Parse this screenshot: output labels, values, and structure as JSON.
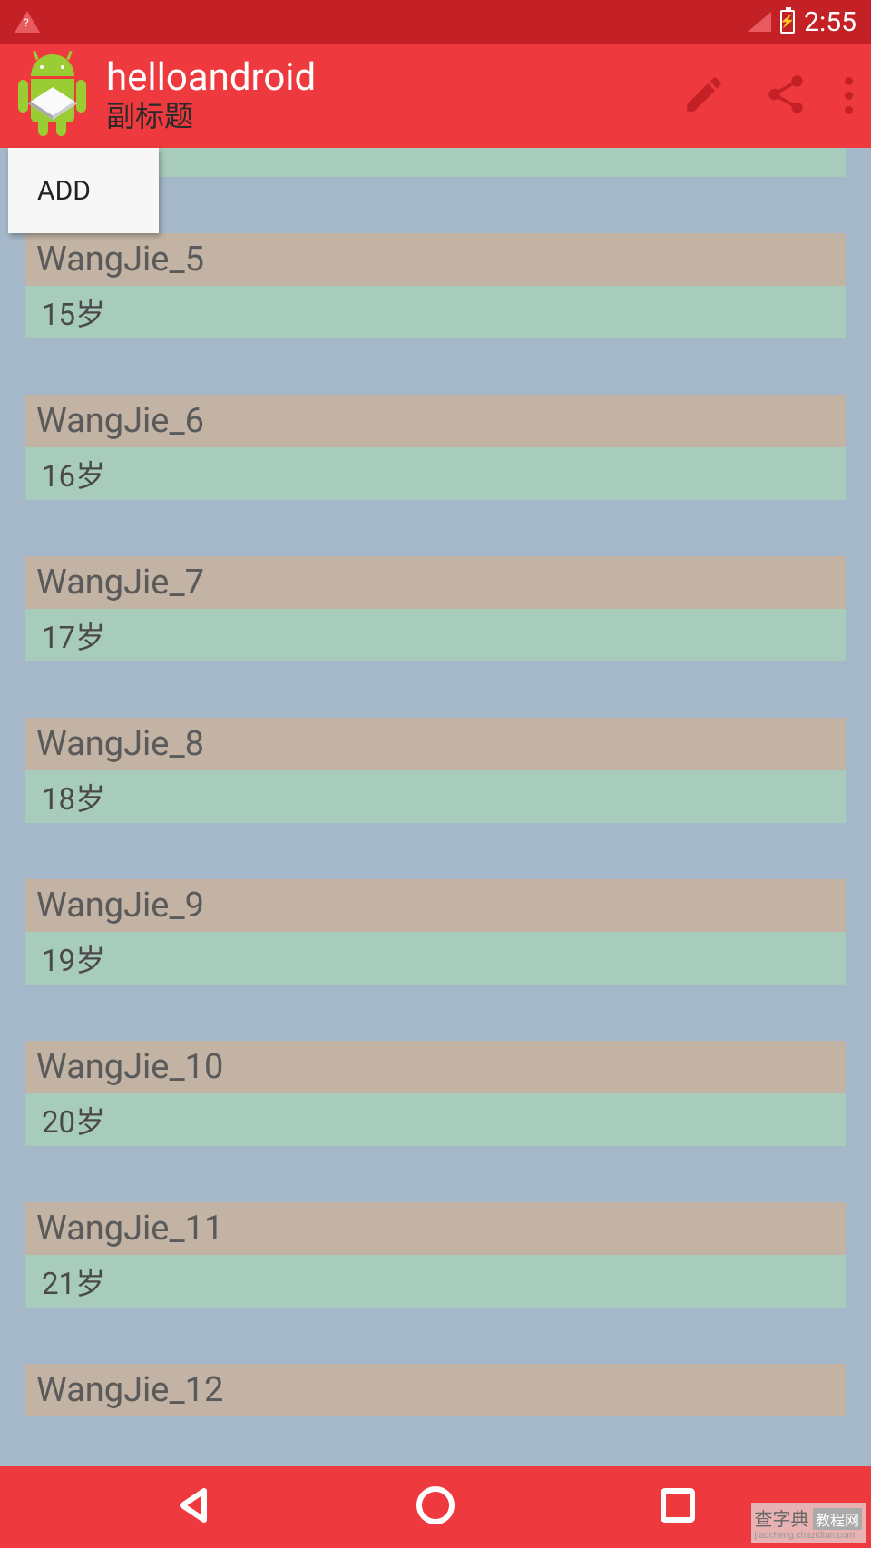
{
  "status": {
    "time": "2:55"
  },
  "toolbar": {
    "title": "helloandroid",
    "subtitle": "副标题"
  },
  "menu": {
    "add_label": "ADD"
  },
  "list": {
    "items": [
      {
        "name": "WangJie_5",
        "age": "15岁"
      },
      {
        "name": "WangJie_6",
        "age": "16岁"
      },
      {
        "name": "WangJie_7",
        "age": "17岁"
      },
      {
        "name": "WangJie_8",
        "age": "18岁"
      },
      {
        "name": "WangJie_9",
        "age": "19岁"
      },
      {
        "name": "WangJie_10",
        "age": "20岁"
      },
      {
        "name": "WangJie_11",
        "age": "21岁"
      },
      {
        "name": "WangJie_12",
        "age": ""
      }
    ]
  },
  "watermark": {
    "text1": "查字典",
    "text2": "教程网",
    "url": "jiaocheng.chazidian.com"
  }
}
